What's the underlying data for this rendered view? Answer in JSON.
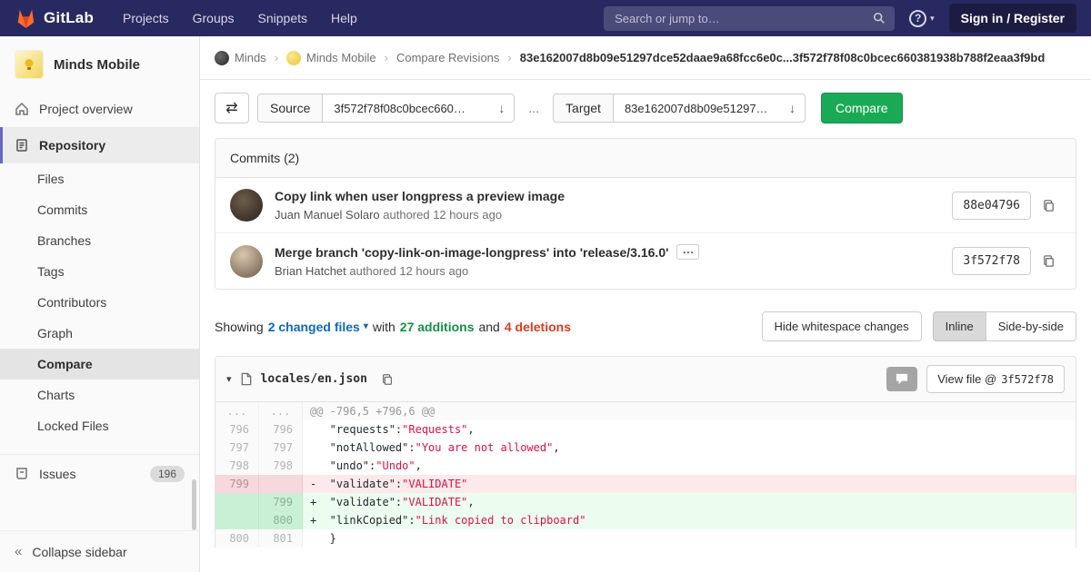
{
  "navbar": {
    "brand": "GitLab",
    "menu": [
      "Projects",
      "Groups",
      "Snippets",
      "Help"
    ],
    "search_placeholder": "Search or jump to…",
    "help_glyph": "?",
    "sign_in": "Sign in / Register"
  },
  "sidebar": {
    "project_name": "Minds Mobile",
    "overview_label": "Project overview",
    "repository_label": "Repository",
    "sub_items": [
      "Files",
      "Commits",
      "Branches",
      "Tags",
      "Contributors",
      "Graph",
      "Compare",
      "Charts",
      "Locked Files"
    ],
    "issues_label": "Issues",
    "issues_count": "196",
    "collapse_label": "Collapse sidebar",
    "collapse_glyph": "«"
  },
  "breadcrumb": {
    "items": [
      "Minds",
      "Minds Mobile",
      "Compare Revisions"
    ],
    "separator": "›",
    "current": "83e162007d8b09e51297dce52daae9a68fcc6e0c...3f572f78f08c0bcec660381938b788f2eaa3f9bd"
  },
  "compare_form": {
    "swap_glyph": "⇄",
    "source_label": "Source",
    "source_value": "3f572f78f08c0bcec660…",
    "arrow_glyph": "↓",
    "separator": "...",
    "target_label": "Target",
    "target_value": "83e162007d8b09e51297…",
    "compare_button": "Compare"
  },
  "commits": {
    "header": "Commits (2)",
    "items": [
      {
        "title": "Copy link when user longpress a preview image",
        "author": "Juan Manuel Solaro",
        "meta": "authored 12 hours ago",
        "sha": "88e04796"
      },
      {
        "title": "Merge branch 'copy-link-on-image-longpress' into 'release/3.16.0'",
        "ellipsis": "…",
        "author": "Brian Hatchet",
        "meta": "authored 12 hours ago",
        "sha": "3f572f78"
      }
    ]
  },
  "diff_summary": {
    "showing": "Showing",
    "changed_files": "2 changed files",
    "caret": "▾",
    "with": "with",
    "additions": "27 additions",
    "and": "and",
    "deletions": "4 deletions",
    "hide_whitespace": "Hide whitespace changes",
    "inline": "Inline",
    "side_by_side": "Side-by-side"
  },
  "diff_file": {
    "caret": "▾",
    "filename": "locales/en.json",
    "view_file_label": "View file @",
    "view_file_sha": "3f572f78",
    "lines": [
      {
        "old": "...",
        "new": "...",
        "sign": "",
        "key": "@@ -796,5 +796,6 @@",
        "value": "",
        "tail": ""
      },
      {
        "old": "796",
        "new": "796",
        "sign": " ",
        "key": "  \"requests\":",
        "value": "\"Requests\"",
        "tail": ","
      },
      {
        "old": "797",
        "new": "797",
        "sign": " ",
        "key": "  \"notAllowed\":",
        "value": "\"You are not allowed\"",
        "tail": ","
      },
      {
        "old": "798",
        "new": "798",
        "sign": " ",
        "key": "  \"undo\":",
        "value": "\"Undo\"",
        "tail": ","
      },
      {
        "old": "799",
        "new": "",
        "sign": "-",
        "key": "  \"validate\":",
        "value": "\"VALIDATE\"",
        "tail": ""
      },
      {
        "old": "",
        "new": "799",
        "sign": "+",
        "key": "  \"validate\":",
        "value": "\"VALIDATE\"",
        "tail": ","
      },
      {
        "old": "",
        "new": "800",
        "sign": "+",
        "key": "  \"linkCopied\":",
        "value": "\"Link copied to clipboard\"",
        "tail": ""
      },
      {
        "old": "800",
        "new": "801",
        "sign": " ",
        "key": "  }",
        "value": "",
        "tail": ""
      }
    ]
  }
}
